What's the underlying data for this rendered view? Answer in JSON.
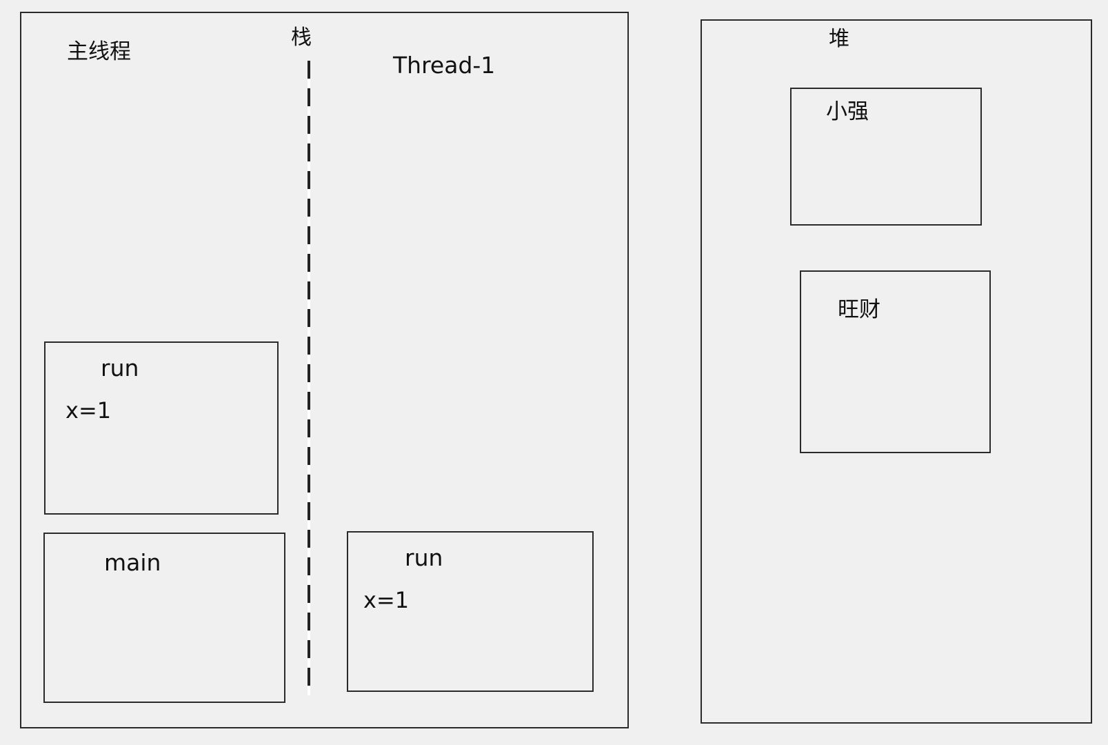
{
  "stack": {
    "title": "栈",
    "main_thread_label": "主线程",
    "thread1_label": "Thread-1",
    "main_thread_frames": {
      "run": {
        "name": "run",
        "var": "x=1"
      },
      "main": {
        "name": "main"
      }
    },
    "thread1_frames": {
      "run": {
        "name": "run",
        "var": "x=1"
      }
    }
  },
  "heap": {
    "title": "堆",
    "objects": [
      "小强",
      "旺财"
    ]
  }
}
